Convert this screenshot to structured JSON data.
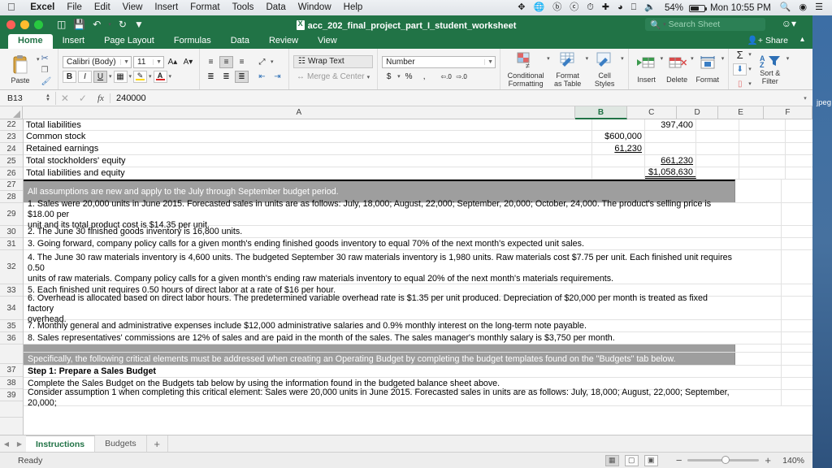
{
  "macbar": {
    "app": "Excel",
    "menus": [
      "File",
      "Edit",
      "View",
      "Insert",
      "Format",
      "Tools",
      "Data",
      "Window",
      "Help"
    ],
    "battery": "54%",
    "clock": "Mon 10:55 PM",
    "icons": [
      "dropbox-icon",
      "globe-icon",
      "b-circle-icon",
      "at-circle-icon",
      "clock-icon",
      "bluetooth-icon",
      "wifi-icon",
      "airplay-icon",
      "volume-icon"
    ],
    "search_icon": "search-icon",
    "siri_icon": "siri-icon",
    "notification_icon": "notification-center-icon"
  },
  "titlebar": {
    "document": "acc_202_final_project_part_I_student_worksheet",
    "search_placeholder": "Search Sheet",
    "quick_access": [
      "sidebar-toggle-icon",
      "save-icon",
      "undo-icon",
      "redo-icon",
      "customize-icon"
    ]
  },
  "ribbon": {
    "tabs": [
      "Home",
      "Insert",
      "Page Layout",
      "Formulas",
      "Data",
      "Review",
      "View"
    ],
    "active_tab": "Home",
    "share_label": "Share",
    "clipboard": {
      "paste": "Paste",
      "cut": "cut-icon",
      "copy": "copy-icon",
      "format_painter": "format-painter-icon"
    },
    "font": {
      "family": "Calibri (Body)",
      "size": "11",
      "grow": "A▴",
      "shrink": "A▾",
      "bold": "B",
      "italic": "I",
      "underline": "U",
      "borders": "borders-icon",
      "fill": "fill-color-icon",
      "fontcolor": "font-color-icon"
    },
    "alignment": {
      "wrap_text": "Wrap Text",
      "merge_center": "Merge & Center",
      "orientation": "orientation-icon"
    },
    "number": {
      "format": "Number",
      "currency": "$",
      "percent": "%",
      "comma": ",",
      "inc_dec": "increase-decimal-icon",
      "dec_dec": "decrease-decimal-icon"
    },
    "styles": {
      "conditional_formatting": "Conditional\nFormatting",
      "conditional_formatting_l1": "Conditional",
      "conditional_formatting_l2": "Formatting",
      "format_as_table_l1": "Format",
      "format_as_table_l2": "as Table",
      "cell_styles_l1": "Cell",
      "cell_styles_l2": "Styles"
    },
    "cells": {
      "insert": "Insert",
      "delete": "Delete",
      "format": "Format"
    },
    "editing": {
      "autosum": "Σ",
      "fill": "fill-down-icon",
      "clear": "clear-icon",
      "sort_l1": "Sort &",
      "sort_l2": "Filter"
    }
  },
  "formula_bar": {
    "name_box": "B13",
    "cancel": "✕",
    "enter": "✓",
    "fx": "fx",
    "content": "240000"
  },
  "grid": {
    "columns": [
      "A",
      "B",
      "C",
      "D",
      "E",
      "F"
    ],
    "selected_column": "B",
    "rows": [
      {
        "num": "22",
        "a": "    Total liabilities",
        "b": "",
        "c": "397,400",
        "c_style": "plain"
      },
      {
        "num": "23",
        "a": "Common stock",
        "b": "$600,000",
        "c": "",
        "b_style": "plain"
      },
      {
        "num": "24",
        "a": "Retained earnings",
        "b": "61,230",
        "c": "",
        "b_style": "under"
      },
      {
        "num": "25",
        "a": "Total stockholders' equity",
        "b": "",
        "c": "661,230",
        "c_style": "under"
      },
      {
        "num": "26",
        "a": "Total liabilities and equity",
        "b": "",
        "c": "$1,058,630",
        "c_style": "dunder"
      }
    ],
    "banner1": {
      "rows": [
        "27",
        "28"
      ],
      "text": "All assumptions are new and apply to the July through September budget period."
    },
    "assumptions": [
      {
        "num": "29",
        "lines": [
          "1. Sales were 20,000 units in June 2015. Forecasted sales in units are as follows: July, 18,000; August, 22,000; September, 20,000; October, 24,000. The product's selling price is $18.00 per",
          "unit and its total product cost is $14.35 per unit."
        ]
      },
      {
        "num": "30",
        "lines": [
          "2. The June 30 finished goods inventory is 16,800 units."
        ]
      },
      {
        "num": "31",
        "lines": [
          "3. Going forward, company policy calls for a given month's ending finished goods inventory to equal 70% of the next month's expected unit sales."
        ]
      },
      {
        "num": "32",
        "lines": [
          "4. The June 30 raw materials inventory is 4,600 units. The budgeted September 30 raw materials inventory is 1,980 units. Raw materials cost $7.75 per unit. Each finished unit requires 0.50",
          "units of raw materials. Company policy calls for a given month's ending raw materials inventory to equal 20% of the next month's materials requirements."
        ]
      },
      {
        "num": "33",
        "lines": [
          "5. Each finished unit requires 0.50 hours of direct labor at a rate of $16 per hour."
        ]
      },
      {
        "num": "34",
        "lines": [
          "6. Overhead is allocated based on direct labor hours. The predetermined variable overhead rate is $1.35 per unit produced. Depreciation of $20,000 per month is treated as fixed factory",
          "overhead."
        ]
      },
      {
        "num": "35",
        "lines": [
          "7. Monthly general and administrative expenses include $12,000 administrative salaries and 0.9% monthly interest on the long-term note payable."
        ]
      },
      {
        "num": "36",
        "lines": [
          "8. Sales representatives' commissions are 12% of sales and are paid in the month of the sales. The sales manager's monthly salary is $3,750 per month."
        ]
      }
    ],
    "banner2": {
      "num": "37",
      "text": "Specifically, the following critical elements must be addressed when creating an Operating Budget by completing the budget templates found on the \"Budgets\" tab below."
    },
    "steps": [
      {
        "num": "38",
        "text": "Step 1: Prepare a Sales Budget",
        "bold": true
      },
      {
        "num": "39",
        "text": "Complete the Sales Budget on the Budgets tab below by using the information found in the budgeted balance sheet above.",
        "bold": false
      },
      {
        "num": "",
        "text": "Consider assumption 1 when completing this critical element: Sales were 20,000 units in June 2015. Forecasted sales in units are as follows: July, 18,000; August, 22,000; September, 20,000;",
        "bold": false
      }
    ]
  },
  "sheet_tabs": {
    "prev": "◀",
    "next": "▶",
    "tabs": [
      "Instructions",
      "Budgets"
    ],
    "active": "Instructions",
    "add": "+"
  },
  "status_bar": {
    "state": "Ready",
    "views": [
      "normal-view-icon",
      "page-layout-view-icon",
      "page-break-view-icon"
    ],
    "zoom_out": "−",
    "zoom_in": "+",
    "zoom": "140%"
  },
  "desktop": {
    "file_label": "jpeg"
  },
  "colors": {
    "excel_green": "#217346",
    "banner_gray": "#9e9e9e",
    "ribbon_bg": "#f4f4f4"
  }
}
